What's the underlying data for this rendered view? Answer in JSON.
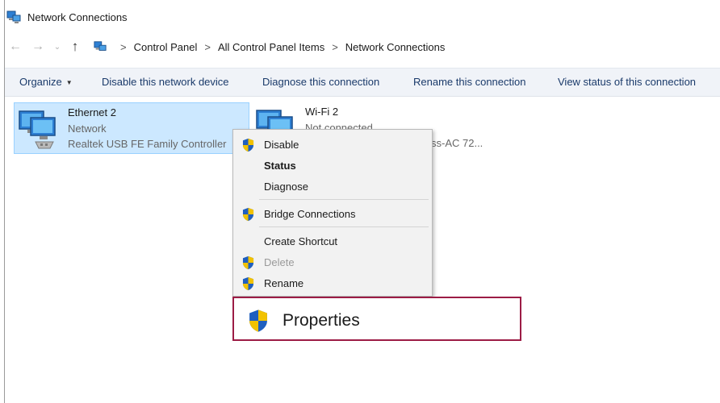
{
  "window": {
    "title": "Network Connections"
  },
  "address_bar": {
    "back_glyph": "←",
    "forward_glyph": "→",
    "recent_glyph": "⌄",
    "up_glyph": "↑",
    "breadcrumb_sep": ">",
    "crumbs": [
      "Control Panel",
      "All Control Panel Items",
      "Network Connections"
    ]
  },
  "command_bar": {
    "organize": "Organize",
    "disable_device": "Disable this network device",
    "diagnose": "Diagnose this connection",
    "rename": "Rename this connection",
    "view_status": "View status of this connection"
  },
  "connections": [
    {
      "name": "Ethernet 2",
      "status": "Network",
      "adapter": "Realtek USB FE Family Controller",
      "selected": true
    },
    {
      "name": "Wi-Fi 2",
      "status": "Not connected",
      "adapter": "ss-AC 72...",
      "selected": false
    }
  ],
  "context_menu": {
    "items": [
      {
        "label": "Disable",
        "shield": true,
        "bold": false,
        "disabled": false
      },
      {
        "label": "Status",
        "shield": false,
        "bold": true,
        "disabled": false
      },
      {
        "label": "Diagnose",
        "shield": false,
        "bold": false,
        "disabled": false
      },
      {
        "label": "Bridge Connections",
        "shield": true,
        "bold": false,
        "disabled": false
      },
      {
        "label": "Create Shortcut",
        "shield": false,
        "bold": false,
        "disabled": false
      },
      {
        "label": "Delete",
        "shield": true,
        "bold": false,
        "disabled": true
      },
      {
        "label": "Rename",
        "shield": true,
        "bold": false,
        "disabled": false
      }
    ],
    "highlighted": {
      "label": "Properties",
      "shield": true
    }
  },
  "colors": {
    "selection_fill": "#cce8ff",
    "selection_border": "#99d1ff",
    "callout_border": "#9c1c45",
    "shield_blue": "#1f5fbf",
    "shield_yellow": "#f2c200"
  },
  "icons": {
    "app": "network-connections-icon",
    "adapter": "network-adapter-icon",
    "uac": "uac-shield-icon"
  }
}
